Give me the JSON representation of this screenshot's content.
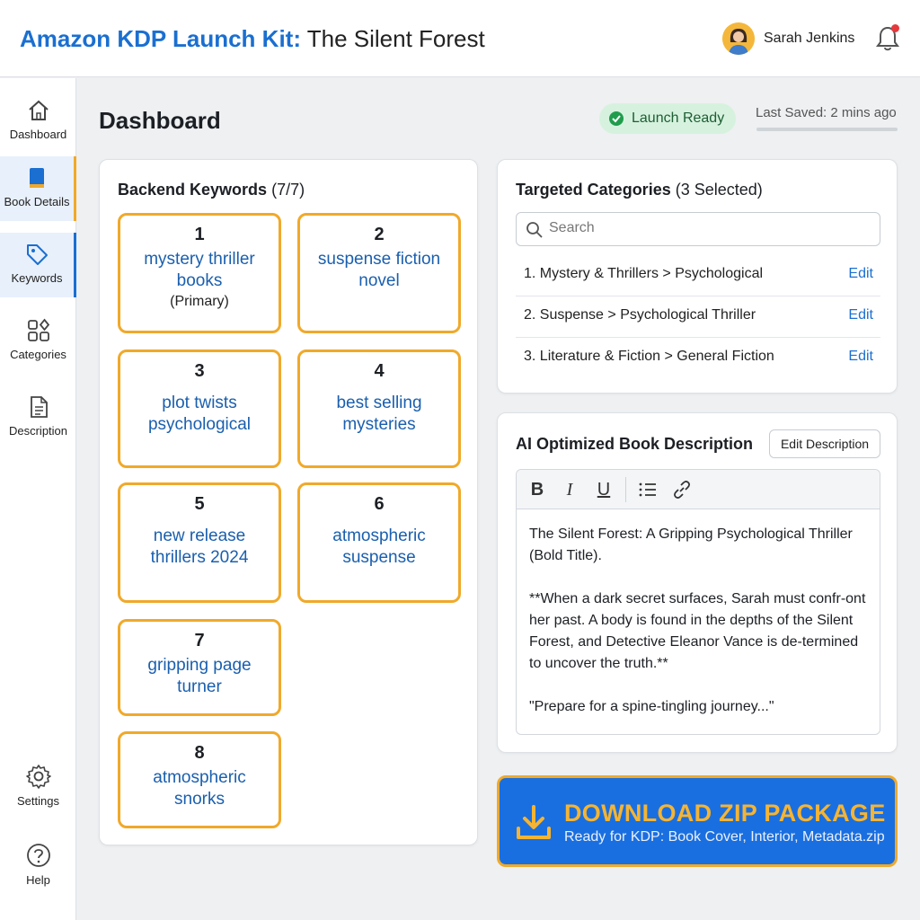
{
  "header": {
    "brand": "Amazon KDP Launch Kit:",
    "book_title": "The Silent Forest",
    "user_name": "Sarah Jenkins"
  },
  "sidebar": {
    "items": [
      {
        "label": "Dashboard",
        "icon": "home-icon"
      },
      {
        "label": "Book Details",
        "icon": "book-icon"
      },
      {
        "label": "Keywords",
        "icon": "tag-icon"
      },
      {
        "label": "Categories",
        "icon": "grid-icon"
      },
      {
        "label": "Description",
        "icon": "document-icon"
      },
      {
        "label": "Settings",
        "icon": "gear-icon"
      },
      {
        "label": "Help",
        "icon": "help-icon"
      }
    ]
  },
  "main": {
    "title": "Dashboard",
    "status": "Launch Ready",
    "last_saved": "Last Saved: 2 mins ago"
  },
  "keywords": {
    "title": "Backend Keywords",
    "count": "(7/7)",
    "items": [
      {
        "num": "1",
        "text": "mystery thriller books",
        "sub": "(Primary)"
      },
      {
        "num": "2",
        "text": "suspense fiction novel"
      },
      {
        "num": "3",
        "text": "plot twists psychological"
      },
      {
        "num": "4",
        "text": "best selling mysteries"
      },
      {
        "num": "5",
        "text": "new release thrillers 2024"
      },
      {
        "num": "6",
        "text": "atmospheric suspense"
      },
      {
        "num": "7",
        "text": "gripping page turner"
      },
      {
        "num": "8",
        "text": "atmospheric snorks"
      }
    ]
  },
  "categories": {
    "title": "Targeted Categories",
    "count": "(3 Selected)",
    "search_placeholder": "Search",
    "edit_label": "Edit",
    "items": [
      "1. Mystery & Thrillers > Psychological",
      "2. Suspense > Psychological Thriller",
      "3. Literature & Fiction > General Fiction"
    ]
  },
  "description": {
    "title": "AI Optimized Book Description",
    "edit_button": "Edit Description",
    "paragraphs": [
      "The Silent Forest: A Gripping Psychological Thriller (Bold Title).",
      "**When a dark secret surfaces, Sarah must confr-ont her past. A body is found in the depths of the Silent Forest, and Detective Eleanor Vance is de-termined to uncover the truth.**",
      "\"Prepare for a spine-tingling journey...\""
    ]
  },
  "download": {
    "title": "DOWNLOAD ZIP PACKAGE",
    "subtitle": "Ready for KDP: Book Cover, Interior, Metadata.zip"
  },
  "colors": {
    "accent": "#1a6fd1",
    "highlight": "#f0a92a",
    "success": "#1f9d4c",
    "button": "#1a6fe0"
  }
}
